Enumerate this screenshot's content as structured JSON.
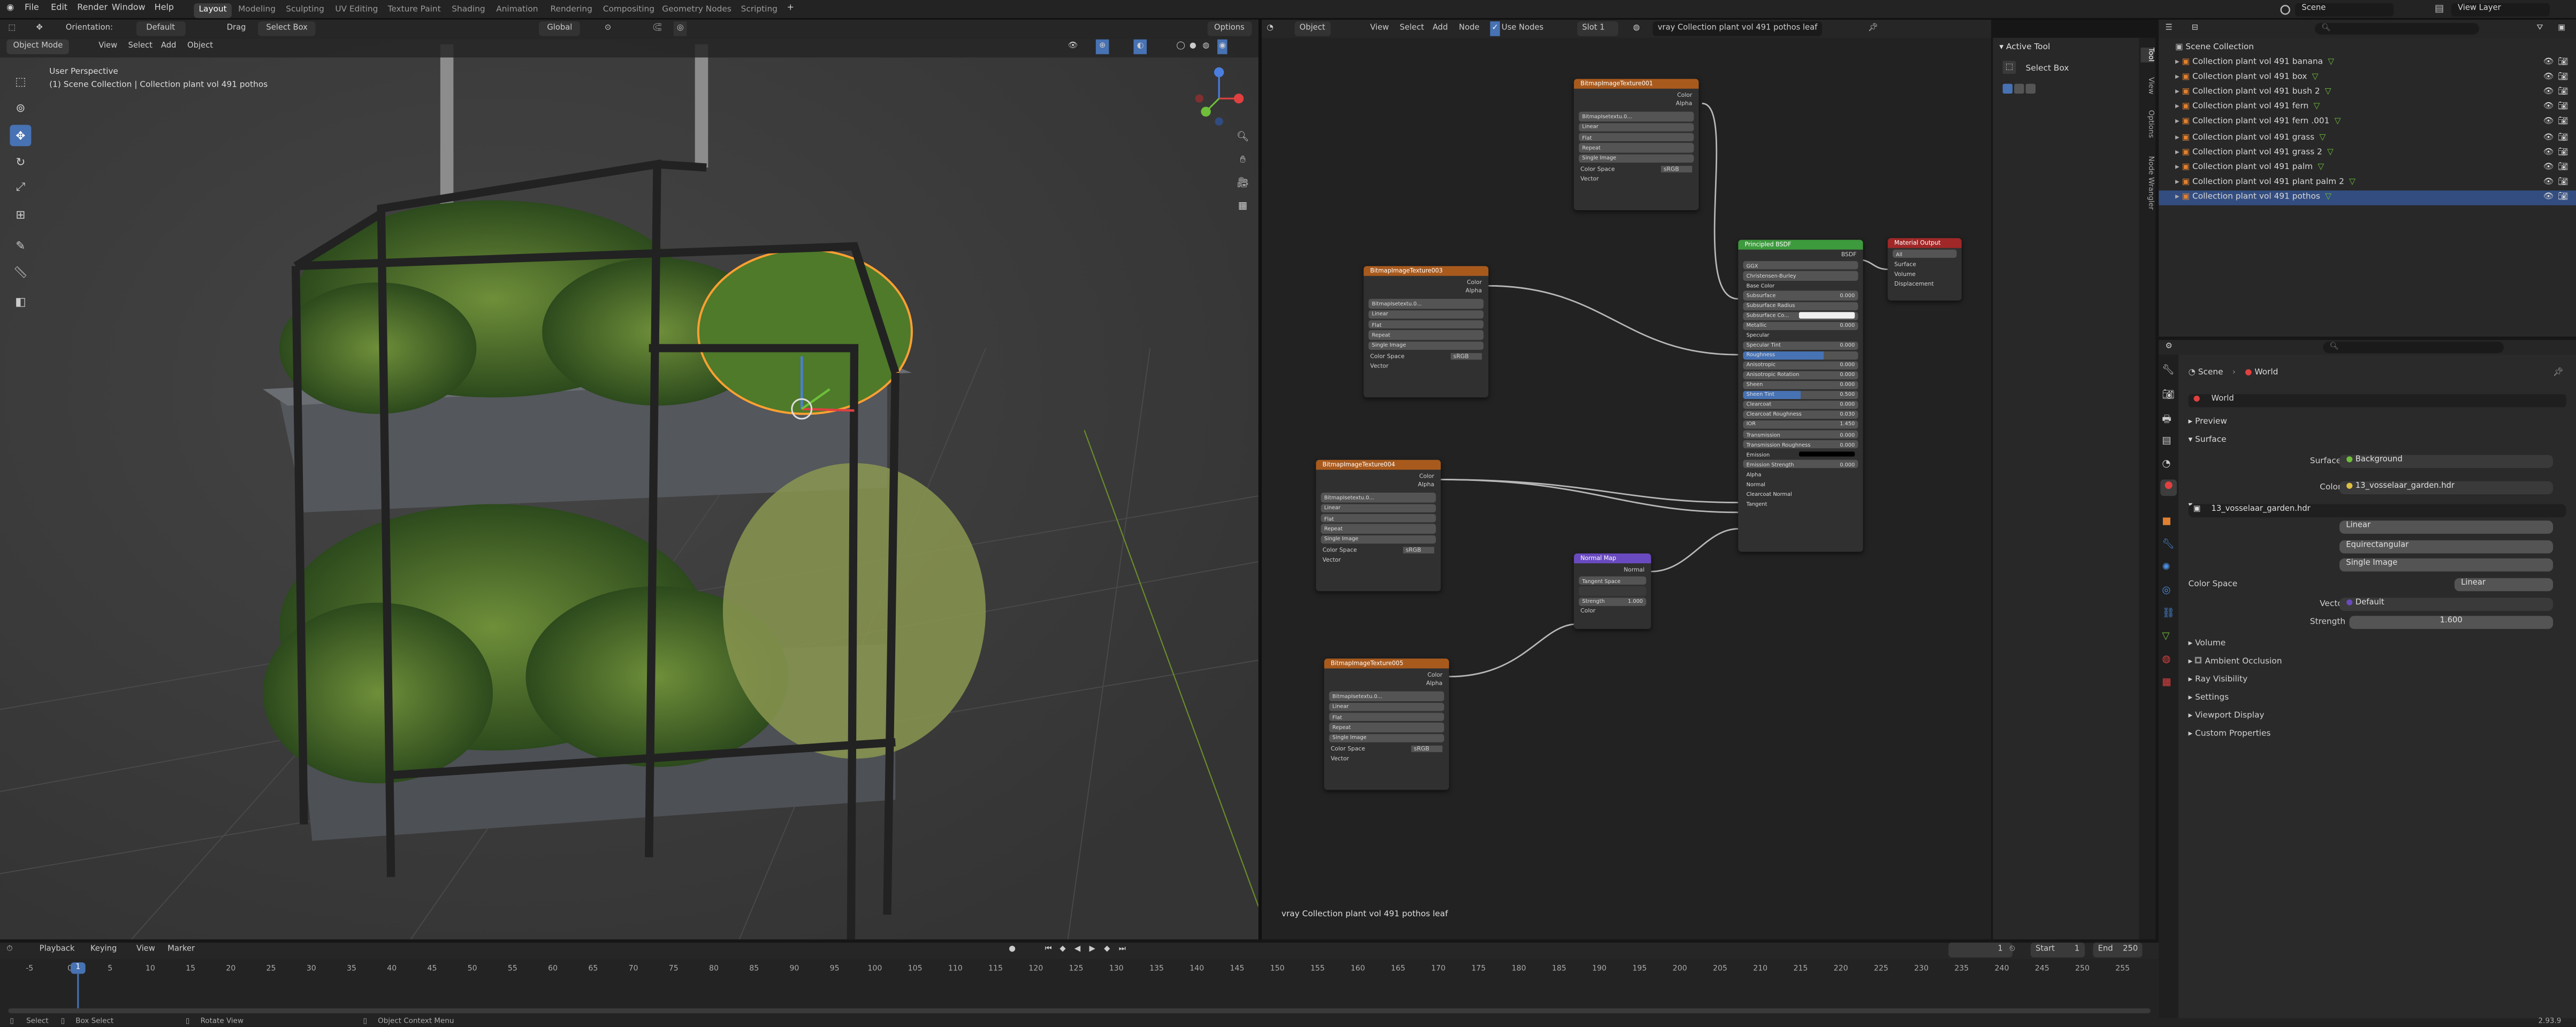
{
  "topbar": {
    "menus": [
      "File",
      "Edit",
      "Render",
      "Window",
      "Help"
    ],
    "workspaces": [
      "Layout",
      "Modeling",
      "Sculpting",
      "UV Editing",
      "Texture Paint",
      "Shading",
      "Animation",
      "Rendering",
      "Compositing",
      "Geometry Nodes",
      "Scripting"
    ],
    "active_workspace": "Layout",
    "scene": "Scene",
    "view_layer": "View Layer"
  },
  "viewport": {
    "orientation_label": "Orientation:",
    "orientation_value": "Default",
    "drag_label": "Drag",
    "drag_value": "Select Box",
    "transform_space": "Global",
    "options": "Options",
    "mode": "Object Mode",
    "menus": [
      "View",
      "Select",
      "Add",
      "Object"
    ],
    "perspective": "User Perspective",
    "collection_info": "(1) Scene Collection | Collection plant vol 491 pothos"
  },
  "node_editor": {
    "editor_type": "Object",
    "menus": [
      "View",
      "Select",
      "Add",
      "Node"
    ],
    "use_nodes": "Use Nodes",
    "slot": "Slot 1",
    "material": "vray Collection plant vol 491 pothos leaf",
    "footer_label": "vray Collection plant vol 491 pothos leaf",
    "image_nodes": [
      {
        "title": "BitmapImageTexture001",
        "image": "BitmapIsetextu.0...",
        "interp": "Linear",
        "proj": "Flat",
        "ext": "Repeat",
        "src": "Single Image",
        "colorspace_label": "Color Space",
        "colorspace": "sRGB",
        "out1": "Color",
        "out2": "Alpha",
        "in1": "Vector"
      },
      {
        "title": "BitmapImageTexture003",
        "image": "BitmapIsetextu.0...",
        "interp": "Linear",
        "proj": "Flat",
        "ext": "Repeat",
        "src": "Single Image",
        "colorspace_label": "Color Space",
        "colorspace": "sRGB",
        "out1": "Color",
        "out2": "Alpha",
        "in1": "Vector"
      },
      {
        "title": "BitmapImageTexture004",
        "image": "BitmapIsetextu.0...",
        "interp": "Linear",
        "proj": "Flat",
        "ext": "Repeat",
        "src": "Single Image",
        "colorspace_label": "Color Space",
        "colorspace": "sRGB",
        "out1": "Color",
        "out2": "Alpha",
        "in1": "Vector"
      },
      {
        "title": "BitmapImageTexture005",
        "image": "BitmapIsetextu.0...",
        "interp": "Linear",
        "proj": "Flat",
        "ext": "Repeat",
        "src": "Single Image",
        "colorspace_label": "Color Space",
        "colorspace": "sRGB",
        "out1": "Color",
        "out2": "Alpha",
        "in1": "Vector"
      }
    ],
    "normal_map": {
      "title": "Normal Map",
      "out": "Normal",
      "space": "Tangent Space",
      "strength_label": "Strength",
      "strength": "1.000",
      "in": "Color"
    },
    "bsdf": {
      "title": "Principled BSDF",
      "out": "BSDF",
      "distribution": "GGX",
      "subsurface_method": "Christensen-Burley",
      "rows": [
        {
          "k": "Base Color",
          "v": ""
        },
        {
          "k": "Subsurface",
          "v": "0.000"
        },
        {
          "k": "Subsurface Radius",
          "v": ""
        },
        {
          "k": "Subsurface Co...",
          "v": ""
        },
        {
          "k": "Metallic",
          "v": "0.000"
        },
        {
          "k": "Specular",
          "v": ""
        },
        {
          "k": "Specular Tint",
          "v": "0.000"
        },
        {
          "k": "Roughness",
          "v": ""
        },
        {
          "k": "Anisotropic",
          "v": "0.000"
        },
        {
          "k": "Anisotropic Rotation",
          "v": "0.000"
        },
        {
          "k": "Sheen",
          "v": "0.000"
        },
        {
          "k": "Sheen Tint",
          "v": "0.500"
        },
        {
          "k": "Clearcoat",
          "v": "0.000"
        },
        {
          "k": "Clearcoat Roughness",
          "v": "0.030"
        },
        {
          "k": "IOR",
          "v": "1.450"
        },
        {
          "k": "Transmission",
          "v": "0.000"
        },
        {
          "k": "Transmission Roughness",
          "v": "0.000"
        },
        {
          "k": "Emission",
          "v": ""
        },
        {
          "k": "Emission Strength",
          "v": "0.000"
        },
        {
          "k": "Alpha",
          "v": ""
        },
        {
          "k": "Normal",
          "v": ""
        },
        {
          "k": "Clearcoat Normal",
          "v": ""
        },
        {
          "k": "Tangent",
          "v": ""
        }
      ]
    },
    "output": {
      "title": "Material Output",
      "target": "All",
      "in1": "Surface",
      "in2": "Volume",
      "in3": "Displacement"
    }
  },
  "npanel": {
    "header": "Active Tool",
    "tool": "Select Box",
    "tabs": [
      "Tool",
      "View",
      "Options",
      "Node Wrangler"
    ]
  },
  "outliner": {
    "root": "Scene Collection",
    "items": [
      "Collection plant vol 491 banana",
      "Collection plant vol 491 box",
      "Collection plant vol 491 bush 2",
      "Collection plant vol 491 fern",
      "Collection plant vol 491 fern .001",
      "Collection plant vol 491 grass",
      "Collection plant vol 491 grass 2",
      "Collection plant vol 491 palm",
      "Collection plant vol 491 plant palm 2",
      "Collection plant vol 491 pothos"
    ],
    "selected_index": 9
  },
  "properties": {
    "scene_crumb": "Scene",
    "world_crumb": "World",
    "world_name": "World",
    "preview": "Preview",
    "surface": "Surface",
    "surface_label": "Surface",
    "surface_value": "Background",
    "color_label": "Color",
    "color_value": "13_vosselaar_garden.hdr",
    "image_name": "13_vosselaar_garden.hdr",
    "interp": "Linear",
    "proj": "Equirectangular",
    "src": "Single Image",
    "colorspace_label": "Color Space",
    "colorspace": "Linear",
    "vector_label": "Vector",
    "vector_value": "Default",
    "strength_label": "Strength",
    "strength_value": "1.600",
    "sections": [
      "Volume",
      "Ambient Occlusion",
      "Ray Visibility",
      "Settings",
      "Viewport Display",
      "Custom Properties"
    ]
  },
  "timeline": {
    "menus": [
      "Playback",
      "Keying",
      "View",
      "Marker"
    ],
    "current_frame": "1",
    "start_label": "Start",
    "start": "1",
    "end_label": "End",
    "end": "250",
    "ticks": [
      "-5",
      "0",
      "5",
      "10",
      "15",
      "20",
      "25",
      "30",
      "35",
      "40",
      "45",
      "50",
      "55",
      "60",
      "65",
      "70",
      "75",
      "80",
      "85",
      "90",
      "95",
      "100",
      "105",
      "110",
      "115",
      "120",
      "125",
      "130",
      "135",
      "140",
      "145",
      "150",
      "155",
      "160",
      "165",
      "170",
      "175",
      "180",
      "185",
      "190",
      "195",
      "200",
      "205",
      "210",
      "215",
      "220",
      "225",
      "230",
      "235",
      "240",
      "245",
      "250",
      "255"
    ]
  },
  "statusbar": {
    "items": [
      "Select",
      "Box Select",
      "Rotate View",
      "Object Context Menu"
    ],
    "version": "2.93.9"
  },
  "colors": {
    "accent": "#4772b3",
    "image_node_header": "#a85a1d",
    "bsdf_header": "#3d9a3d",
    "output_header": "#a02828",
    "normal_header": "#6a4ac0",
    "selection": "#ffa032"
  }
}
